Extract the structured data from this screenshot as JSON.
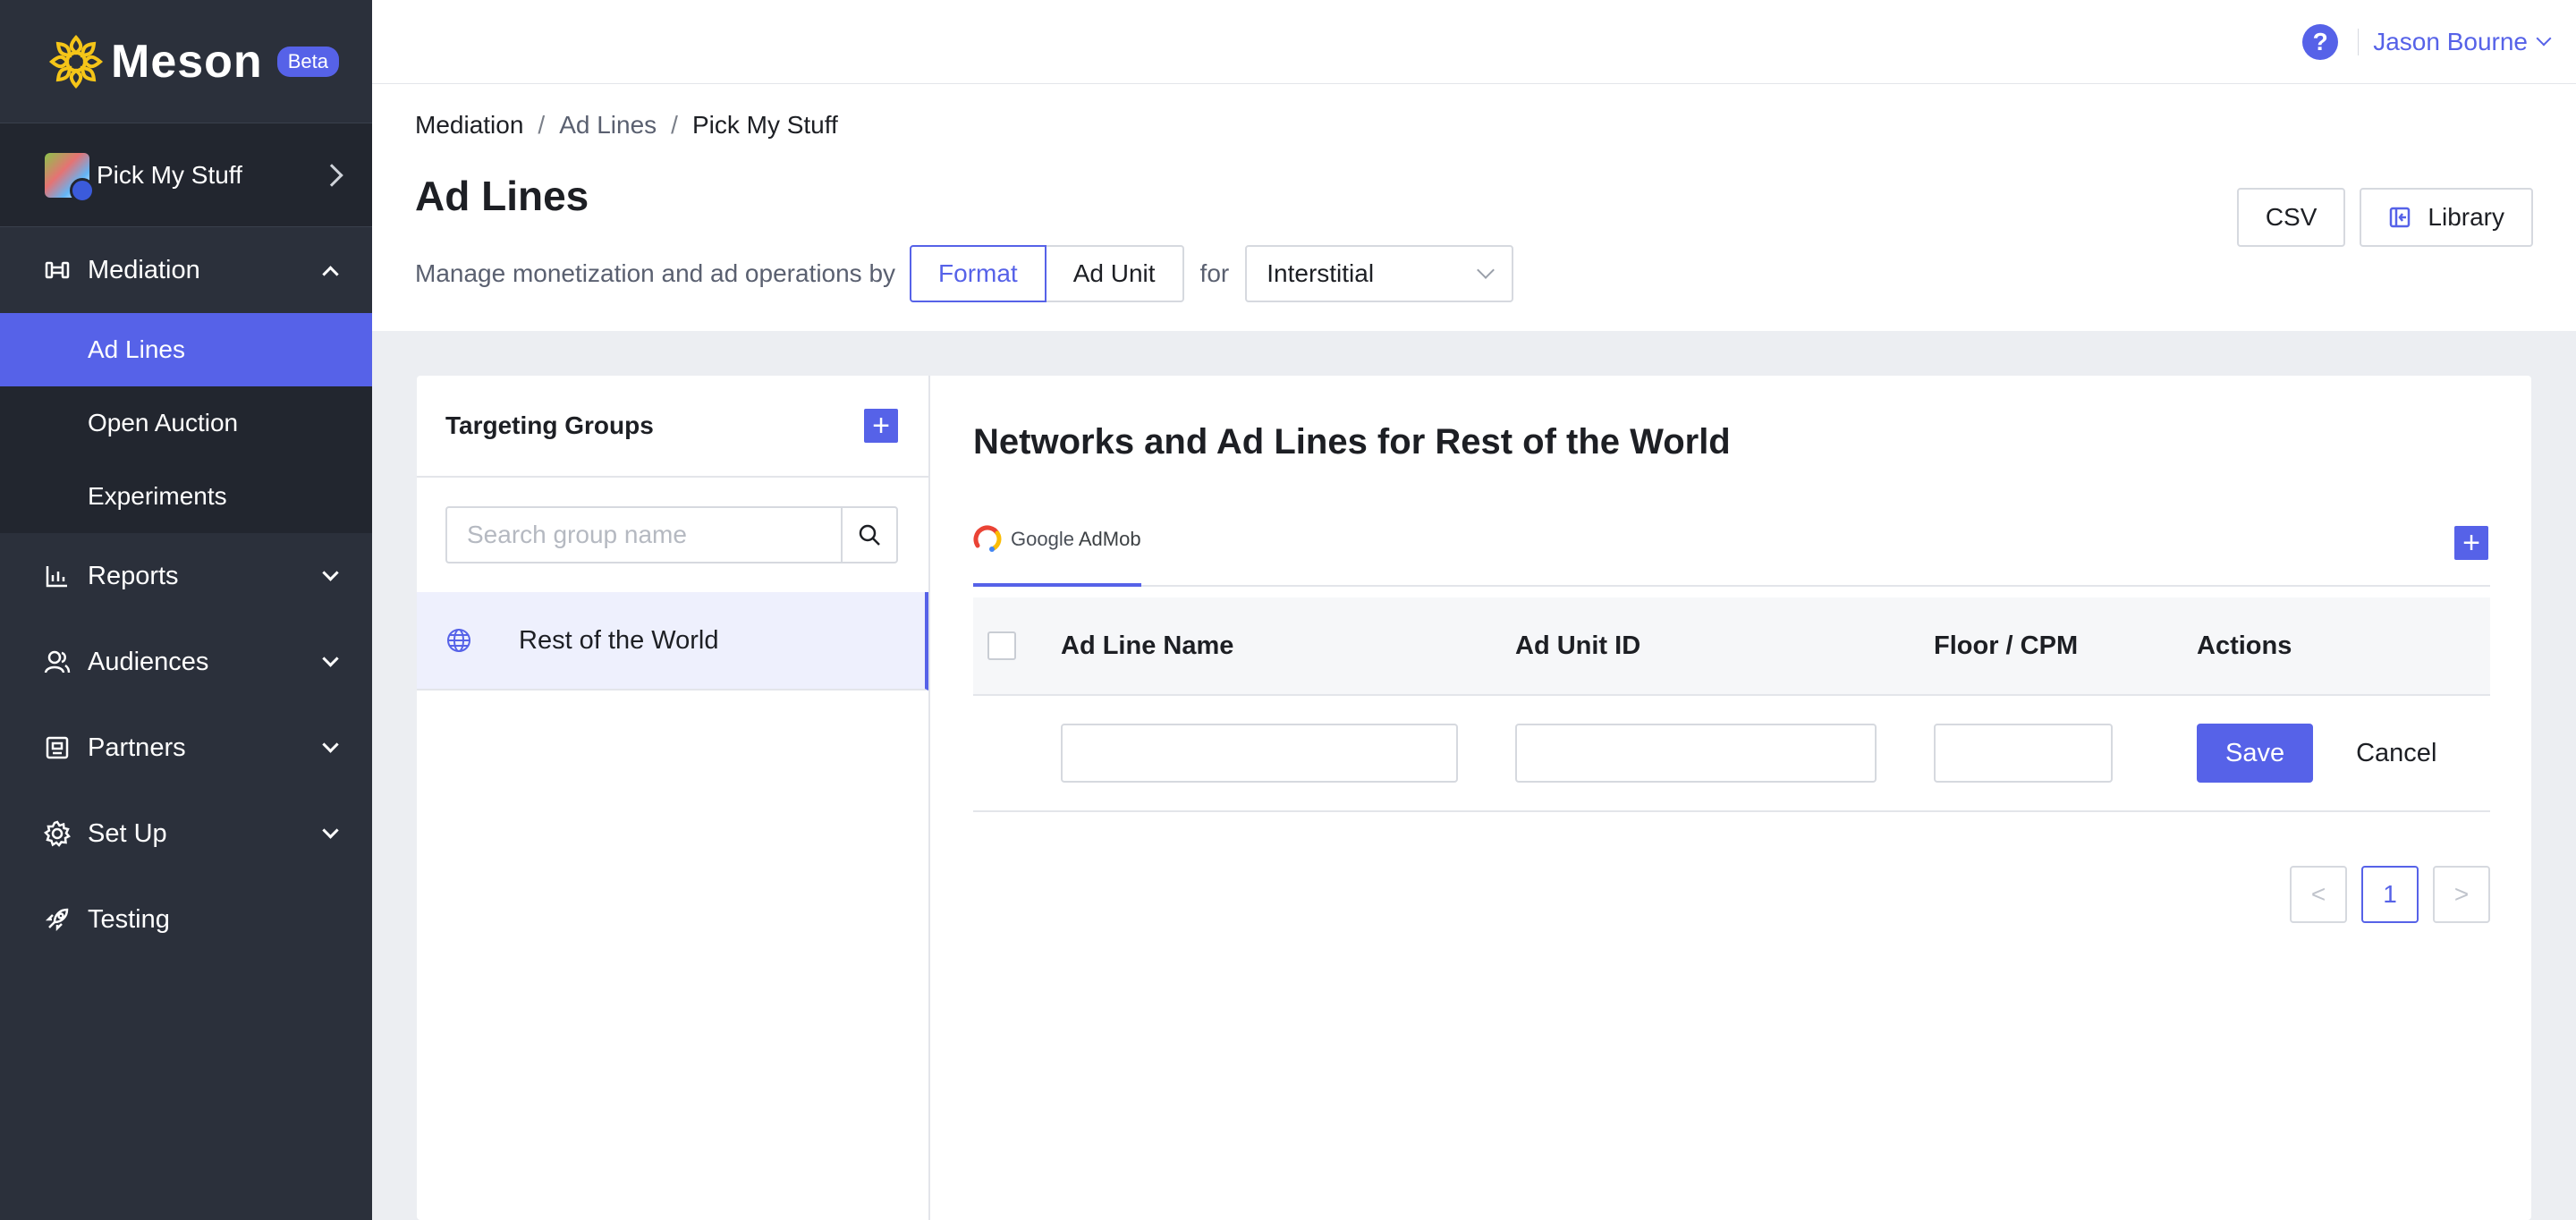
{
  "brand": {
    "name": "Meson",
    "badge": "Beta"
  },
  "app_switcher": {
    "name": "Pick My Stuff"
  },
  "sidebar": {
    "mediation": {
      "label": "Mediation",
      "subitems": [
        "Ad Lines",
        "Open Auction",
        "Experiments"
      ]
    },
    "items": [
      {
        "label": "Reports",
        "icon": "bar-chart-icon"
      },
      {
        "label": "Audiences",
        "icon": "audience-icon"
      },
      {
        "label": "Partners",
        "icon": "partners-icon"
      },
      {
        "label": "Set Up",
        "icon": "gear-icon"
      },
      {
        "label": "Testing",
        "icon": "rocket-icon"
      }
    ]
  },
  "topbar": {
    "help": "?",
    "user": "Jason Bourne"
  },
  "breadcrumb": [
    "Mediation",
    "Ad Lines",
    "Pick My Stuff"
  ],
  "breadcrumb_sep": "/",
  "page": {
    "title": "Ad Lines",
    "csv_label": "CSV",
    "library_label": "Library",
    "filter_prefix": "Manage monetization and ad operations by",
    "seg_format": "Format",
    "seg_ad_unit": "Ad Unit",
    "for_text": "for",
    "format_select": "Interstitial"
  },
  "targeting": {
    "title": "Targeting Groups",
    "add": "+",
    "search_placeholder": "Search group name",
    "groups": [
      "Rest of the World"
    ]
  },
  "networks": {
    "title": "Networks and Ad Lines for Rest of the World",
    "tab_google": "Google",
    "tab_admob": "AdMob",
    "add": "+",
    "columns": [
      "Ad Line Name",
      "Ad Unit ID",
      "Floor / CPM",
      "Actions"
    ],
    "save": "Save",
    "cancel": "Cancel",
    "pager": {
      "prev": "<",
      "current": "1",
      "next": ">"
    }
  },
  "colors": {
    "accent": "#5662e8",
    "sidebar": "#2b303b",
    "logo": "#f5c518"
  }
}
